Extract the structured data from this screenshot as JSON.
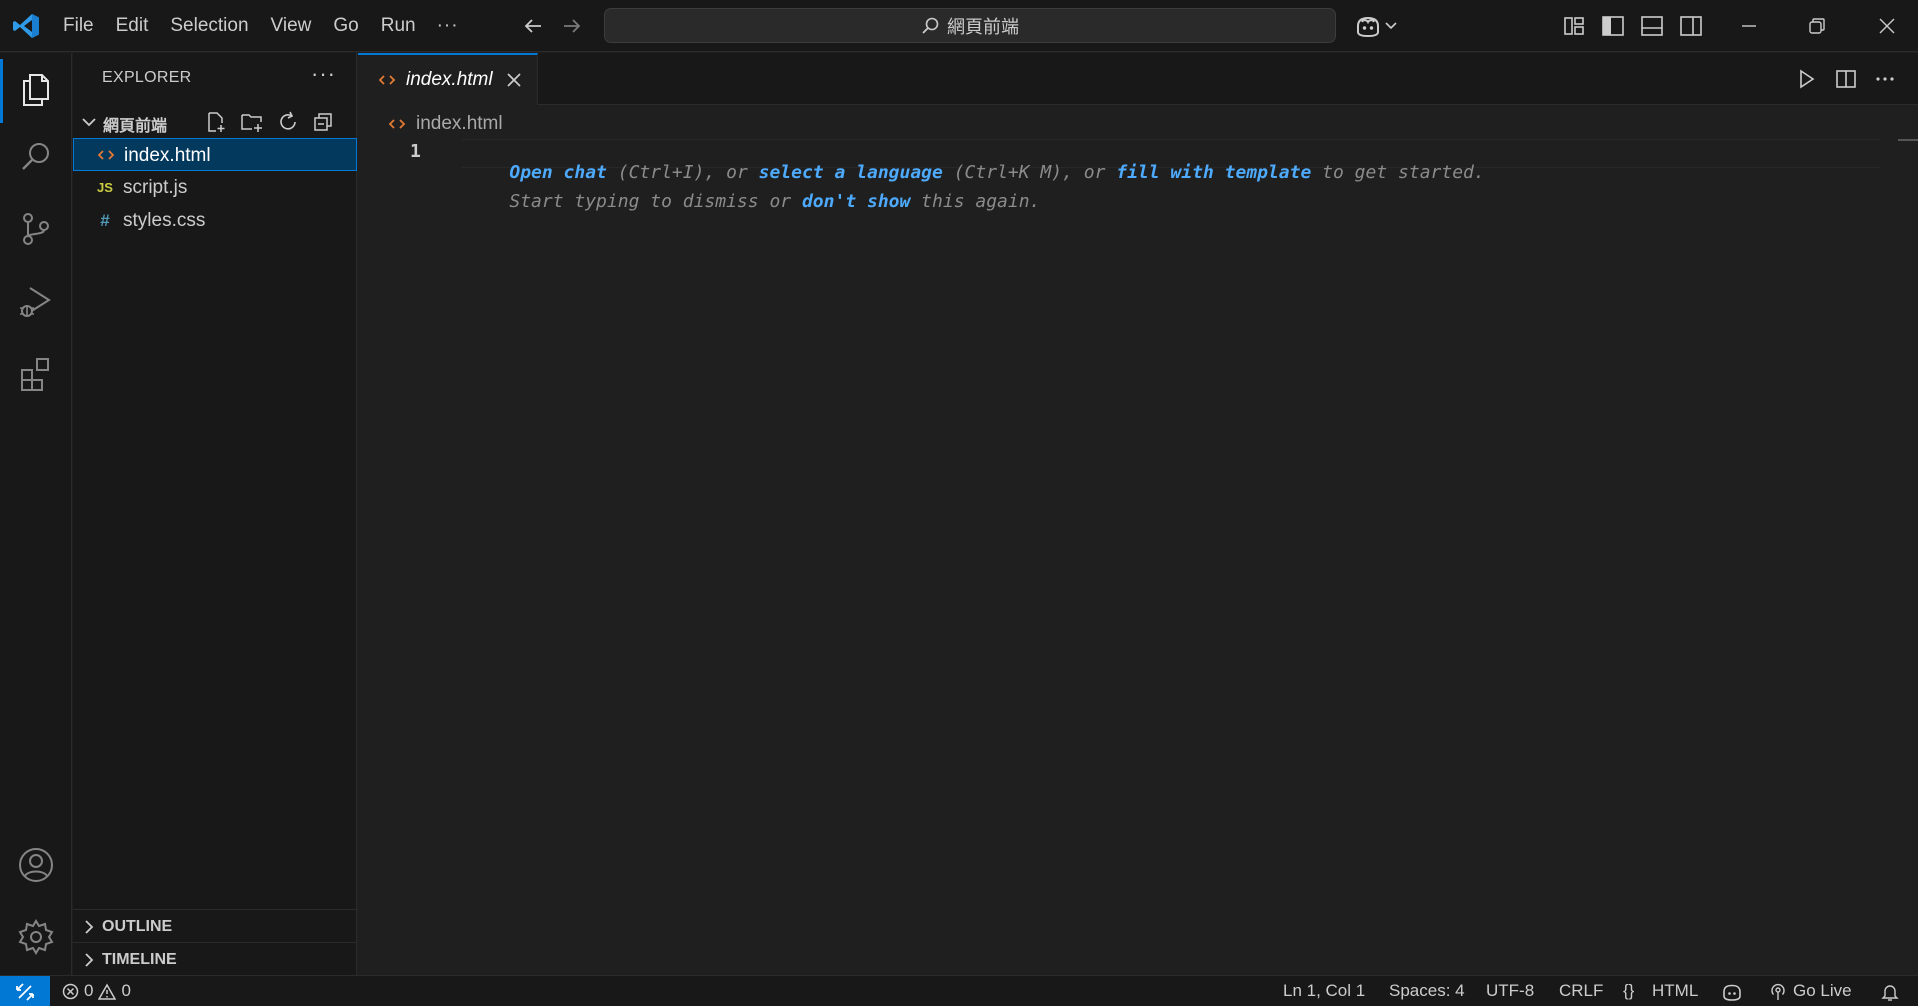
{
  "titlebar": {
    "menu": [
      "File",
      "Edit",
      "Selection",
      "View",
      "Go",
      "Run"
    ],
    "more": "···",
    "search_text": "網頁前端"
  },
  "sidebar": {
    "title": "EXPLORER",
    "more": "···",
    "folder_name": "網頁前端",
    "files": [
      {
        "name": "index.html",
        "icon": "<>",
        "color": "#e37933",
        "selected": true
      },
      {
        "name": "script.js",
        "icon": "JS",
        "color": "#cbcb41",
        "selected": false
      },
      {
        "name": "styles.css",
        "icon": "#",
        "color": "#519aba",
        "selected": false
      }
    ],
    "sections": [
      "OUTLINE",
      "TIMELINE"
    ]
  },
  "editor": {
    "tab_label": "index.html",
    "breadcrumb": "index.html",
    "line_number": "1",
    "hint_line1": [
      {
        "text": "Open chat",
        "link": true
      },
      {
        "text": " (Ctrl+I), or ",
        "link": false
      },
      {
        "text": "select a language",
        "link": true
      },
      {
        "text": " (Ctrl+K M), or ",
        "link": false
      },
      {
        "text": "fill with template",
        "link": true
      },
      {
        "text": " to get started.",
        "link": false
      }
    ],
    "hint_line2": [
      {
        "text": "Start typing to dismiss or ",
        "link": false
      },
      {
        "text": "don't show",
        "link": true
      },
      {
        "text": " this again.",
        "link": false
      }
    ]
  },
  "statusbar": {
    "errors": "0",
    "warnings": "0",
    "position": "Ln 1, Col 1",
    "spaces": "Spaces: 4",
    "encoding": "UTF-8",
    "eol": "CRLF",
    "language_braces": "{}",
    "language": "HTML",
    "go_live": "Go Live"
  },
  "colors": {
    "accent": "#0078d4",
    "link": "#4daafc",
    "html_icon": "#e37933"
  }
}
